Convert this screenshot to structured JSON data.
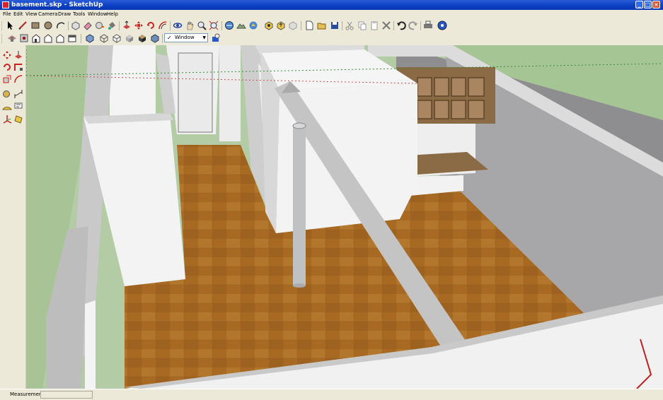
{
  "window": {
    "title": "basement.skp - SketchUp",
    "minimize": "_",
    "maximize": "□",
    "close": "×"
  },
  "menu": [
    "File",
    "Edit",
    "View",
    "Camera",
    "Draw",
    "Tools",
    "Window",
    "Help"
  ],
  "toolbar": {
    "layer_selected": "Window",
    "layer_check": "✓",
    "dropdown_arrow": "▼"
  },
  "status": {
    "measurements_label": "Measurements",
    "measurements_value": ""
  },
  "colors": {
    "title_bar": "#0a3fc2",
    "chrome": "#ece9d8",
    "floor": "#a86a22",
    "grass": "#a5c594",
    "walls": "#f2f2f2",
    "shelf": "#8b6b45",
    "column": "#bfc1c3"
  }
}
